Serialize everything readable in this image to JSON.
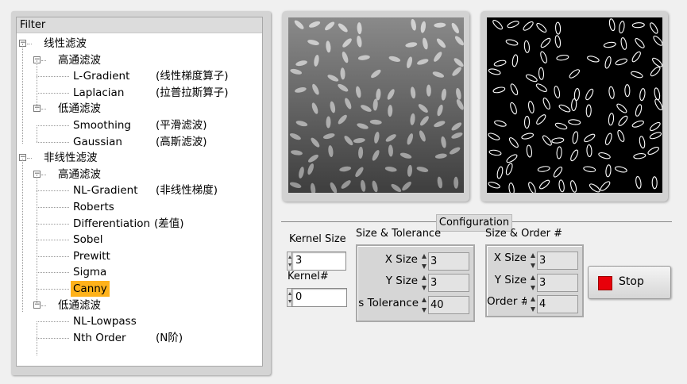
{
  "tree": {
    "header": "Filter",
    "nodes": [
      {
        "label": "线性滤波",
        "desc": ""
      },
      {
        "label": "高通滤波",
        "desc": ""
      },
      {
        "label": "L-Gradient",
        "desc": "(线性梯度算子)"
      },
      {
        "label": "Laplacian",
        "desc": "(拉普拉斯算子)"
      },
      {
        "label": "低通滤波",
        "desc": ""
      },
      {
        "label": "Smoothing",
        "desc": "(平滑滤波)"
      },
      {
        "label": "Gaussian",
        "desc": "(高斯滤波)"
      },
      {
        "label": "非线性滤波",
        "desc": ""
      },
      {
        "label": "高通滤波",
        "desc": ""
      },
      {
        "label": "NL-Gradient",
        "desc": "(非线性梯度)"
      },
      {
        "label": "Roberts",
        "desc": ""
      },
      {
        "label": "Differentiation",
        "desc": "(差值)"
      },
      {
        "label": "Sobel",
        "desc": ""
      },
      {
        "label": "Prewitt",
        "desc": ""
      },
      {
        "label": "Sigma",
        "desc": ""
      },
      {
        "label": "Canny",
        "desc": ""
      },
      {
        "label": "低通滤波",
        "desc": ""
      },
      {
        "label": "NL-Lowpass",
        "desc": ""
      },
      {
        "label": "Nth Order",
        "desc": "(N阶)"
      }
    ],
    "selected": "Canny",
    "toggle_symbol": "−"
  },
  "config": {
    "title": "Configuration",
    "kernel_size_label": "Kernel Size",
    "kernel_size_value": "3",
    "kernel_num_label": "Kernel#",
    "kernel_num_value": "0",
    "size_tolerance": {
      "title": "Size & Tolerance",
      "x_label": "X Size",
      "x_value": "3",
      "y_label": "Y Size",
      "y_value": "3",
      "tol_label": "s Tolerance",
      "tol_value": "40"
    },
    "size_order": {
      "title": "Size & Order #",
      "x_label": "X Size",
      "x_value": "3",
      "y_label": "Y Size",
      "y_value": "3",
      "order_label": "Order #",
      "order_value": "4"
    }
  },
  "stop_button": {
    "label": "Stop",
    "led_color": "#e8000a"
  },
  "colors": {
    "selection": "#ffb21a",
    "panel": "#d4d4d4",
    "background": "#f0f0f0"
  }
}
